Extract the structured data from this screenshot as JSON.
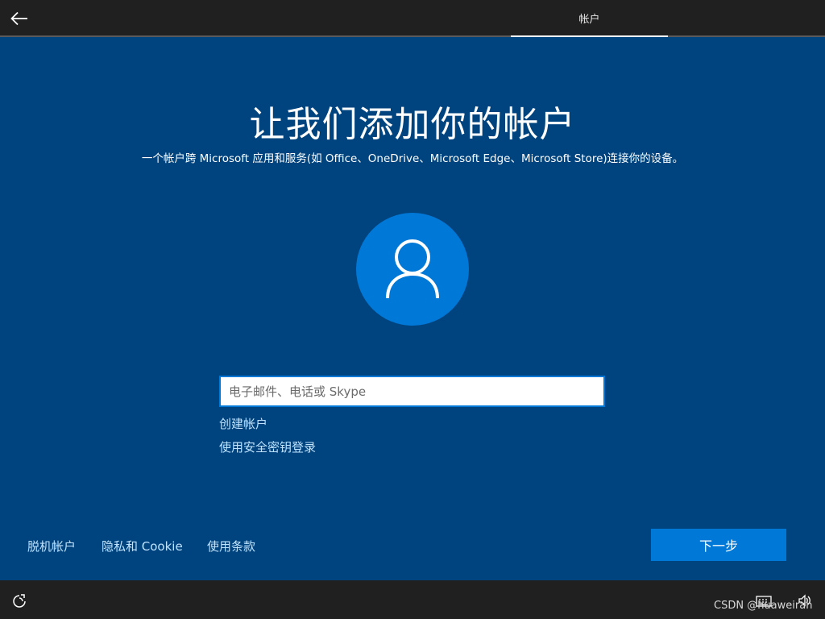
{
  "header": {
    "back_icon": "arrow-left-icon",
    "tab_label": "帐户"
  },
  "main": {
    "title": "让我们添加你的帐户",
    "subtitle": "一个帐户跨 Microsoft 应用和服务(如 Office、OneDrive、Microsoft Edge、Microsoft Store)连接你的设备。",
    "avatar_icon": "user-icon",
    "email_input": {
      "placeholder": "电子邮件、电话或 Skype",
      "value": ""
    },
    "create_account_link": "创建帐户",
    "security_key_link": "使用安全密钥登录"
  },
  "footer": {
    "offline_account": "脱机帐户",
    "privacy_cookie": "隐私和 Cookie",
    "terms": "使用条款",
    "next_button": "下一步"
  },
  "bottombar": {
    "ease_of_access_icon": "ease-of-access-icon",
    "keyboard_icon": "keyboard-icon",
    "volume_icon": "volume-icon",
    "watermark": "CSDN @huaweiran"
  },
  "colors": {
    "background": "#00447f",
    "accent": "#0078d7",
    "bar": "#202020",
    "link": "#bfe3ff"
  }
}
